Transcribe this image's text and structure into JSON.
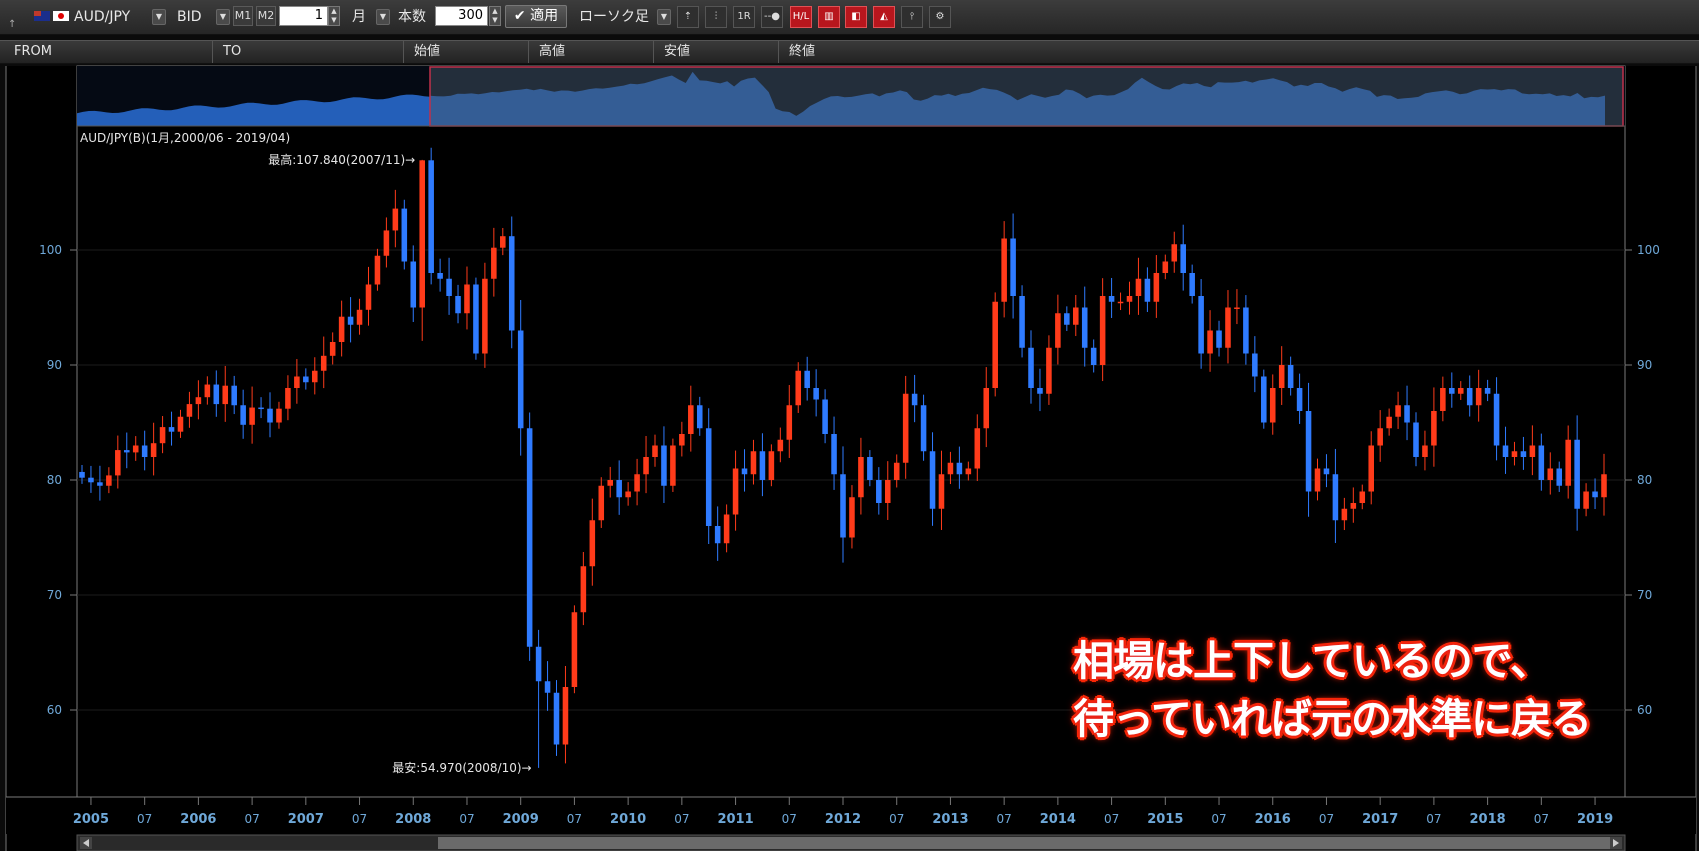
{
  "toolbar": {
    "symbol": "AUD/JPY",
    "price_type": "BID",
    "m1_label": "M1",
    "m2_label": "M2",
    "period_value": "1",
    "period_unit": "月",
    "count_label": "本数",
    "count_value": "300",
    "apply_label": "適用",
    "chart_type": "ローソク足",
    "tool_icons": [
      "trend-icon",
      "bar-icon",
      "1r-icon",
      "line-icon",
      "hl-icon",
      "candle-icon",
      "box-icon",
      "area-icon",
      "compare-icon",
      "settings-icon"
    ],
    "tool_labels": [
      "",
      "",
      "1R",
      "",
      "H/L",
      "",
      "",
      "",
      "",
      ""
    ]
  },
  "header": {
    "columns": [
      "FROM",
      "TO",
      "始値",
      "高値",
      "安値",
      "終値"
    ]
  },
  "overlay": {
    "line1": "相場は上下しているので、",
    "line2": "待っていれば元の水準に戻る"
  },
  "colors": {
    "up": "#ff3b1a",
    "down": "#2f7bff",
    "background": "#000000",
    "axis_text": "#6fa8d8",
    "grid": "#1b1b1b"
  },
  "chart_data": {
    "type": "candlestick",
    "title": "AUD/JPY(B)(1月,2000/06 - 2019/04)",
    "annotations": {
      "high_label": "最高:107.840(2007/11)",
      "low_label": "最安:54.970(2008/10)",
      "high_value": 107.84,
      "low_value": 54.97
    },
    "ylim": [
      54,
      110
    ],
    "y_ticks": [
      60,
      70,
      80,
      90,
      100
    ],
    "x_ticks": [
      "2005",
      "07",
      "2006",
      "07",
      "2007",
      "07",
      "2008",
      "07",
      "2009",
      "07",
      "2010",
      "07",
      "2011",
      "07",
      "2012",
      "07",
      "2013",
      "07",
      "2014",
      "07",
      "2015",
      "07",
      "2016",
      "07",
      "2017",
      "07",
      "2018",
      "07",
      "2019"
    ],
    "start": "2004-12",
    "close": [
      80.2,
      79.8,
      79.5,
      80.4,
      82.6,
      82.4,
      83.0,
      82.0,
      83.2,
      84.6,
      84.2,
      85.5,
      86.6,
      87.2,
      88.3,
      86.6,
      88.2,
      86.5,
      84.8,
      86.3,
      86.2,
      85.0,
      86.2,
      88.0,
      89.0,
      88.5,
      89.5,
      90.8,
      92.0,
      94.2,
      93.5,
      94.8,
      97.0,
      99.5,
      101.7,
      103.6,
      99.0,
      95.0,
      107.8,
      98.0,
      97.5,
      96.0,
      94.5,
      97.0,
      91.0,
      97.5,
      100.2,
      101.2,
      93.0,
      84.5,
      65.5,
      62.5,
      61.5,
      57.0,
      62.0,
      68.5,
      72.5,
      76.5,
      79.5,
      80.0,
      78.5,
      79.0,
      80.5,
      82.0,
      83.0,
      79.5,
      83.0,
      84.0,
      86.5,
      84.5,
      76.0,
      74.5,
      77.0,
      81.0,
      80.5,
      82.5,
      80.0,
      82.5,
      83.5,
      86.5,
      89.5,
      88.0,
      87.0,
      84.0,
      80.5,
      75.0,
      78.5,
      82.0,
      80.0,
      78.0,
      80.0,
      81.5,
      87.5,
      86.5,
      82.5,
      77.5,
      80.5,
      81.5,
      80.5,
      81.0,
      84.5,
      88.0,
      95.5,
      101.0,
      96.0,
      91.5,
      88.0,
      87.5,
      91.5,
      94.5,
      93.5,
      95.0,
      91.5,
      90.0,
      96.0,
      95.5,
      95.5,
      96.0,
      97.5,
      95.5,
      98.0,
      99.0,
      100.5,
      98.0,
      96.0,
      91.0,
      93.0,
      91.5,
      95.0,
      95.0,
      91.0,
      89.0,
      85.0,
      88.0,
      90.0,
      88.0,
      86.0,
      79.0,
      81.0,
      80.5,
      76.5,
      77.5,
      78.0,
      79.0,
      83.0,
      84.5,
      85.5,
      86.5,
      85.0,
      82.0,
      83.0,
      86.0,
      88.0,
      87.5,
      88.0,
      86.5,
      88.0,
      87.5,
      83.0,
      82.0,
      82.5,
      82.0,
      83.0,
      80.0,
      81.0,
      79.5,
      83.5,
      77.5,
      79.0,
      78.5,
      80.5
    ],
    "max_index": 38,
    "min_index": 51
  }
}
